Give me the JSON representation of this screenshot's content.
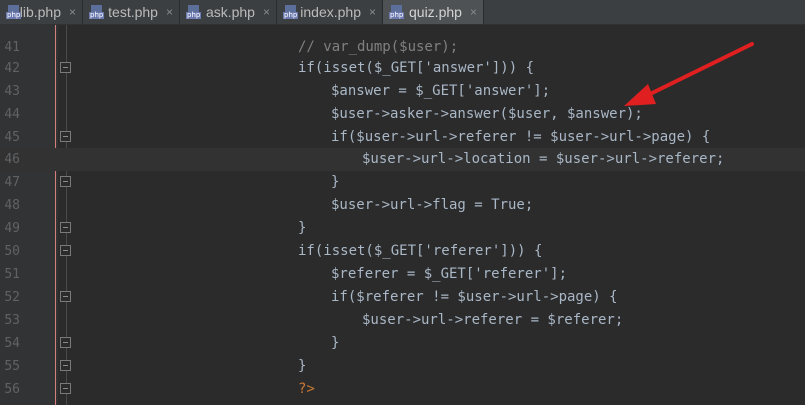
{
  "tabs": [
    {
      "label": "lib.php",
      "active": false
    },
    {
      "label": "test.php",
      "active": false
    },
    {
      "label": "ask.php",
      "active": false
    },
    {
      "label": "index.php",
      "active": false
    },
    {
      "label": "quiz.php",
      "active": true
    }
  ],
  "tab_icon_text": "php",
  "tab_close_glyph": "×",
  "line_numbers": [
    "41",
    "42",
    "43",
    "44",
    "45",
    "46",
    "47",
    "48",
    "49",
    "50",
    "51",
    "52",
    "53",
    "54",
    "55",
    "56"
  ],
  "code_lines": [
    "// var_dump($user);",
    "if(isset($_GET['answer'])) {",
    "$answer = $_GET['answer'];",
    "$user->asker->answer($user, $answer);",
    "if($user->url->referer != $user->url->page) {",
    "$user->url->location = $user->url->referer;",
    "}",
    "$user->url->flag = True;",
    "}",
    "if(isset($_GET['referer'])) {",
    "$referer = $_GET['referer'];",
    "if($referer != $user->url->page) {",
    "$user->url->referer = $referer;",
    "}",
    "}",
    "?>"
  ],
  "current_line": "46",
  "colors": {
    "background": "#2b2b2b",
    "keyword": "#cc7832",
    "variable": "#9876aa",
    "string": "#6a8759",
    "comment": "#808080",
    "arrow": "#e02020"
  },
  "annotation": {
    "icon": "red-arrow-icon"
  }
}
